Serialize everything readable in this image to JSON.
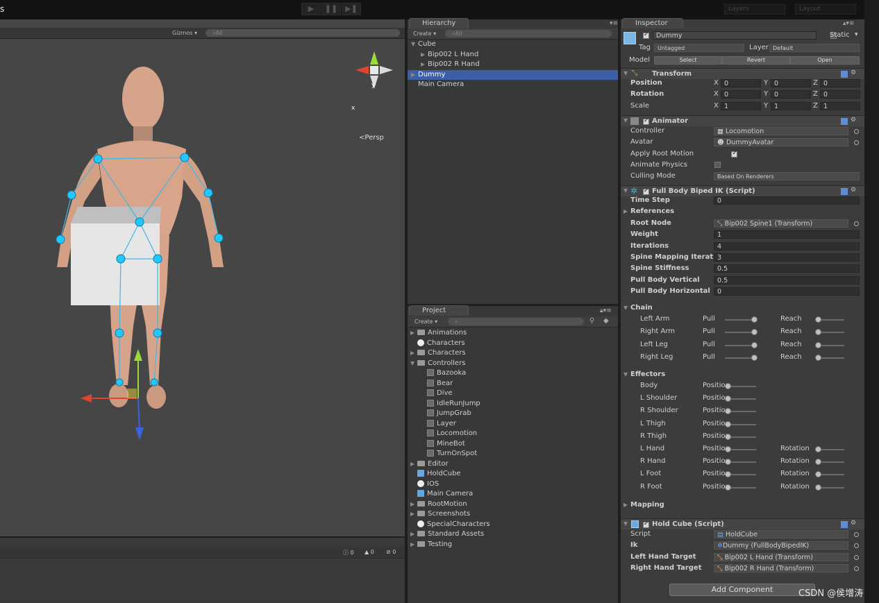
{
  "window": {
    "title": "s",
    "layers": "Layers",
    "layout": "Layout"
  },
  "scene": {
    "gizmos": "Gizmos",
    "search": "All",
    "persp": "Persp",
    "axis_x": "x",
    "axis_y": "y"
  },
  "console": {
    "count_info": "0",
    "count_warn": "0",
    "count_error": "0"
  },
  "hierarchy": {
    "tab": "Hierarchy",
    "create": "Create",
    "search": "All",
    "items": [
      {
        "label": "Cube",
        "indent": 0,
        "arrow": "▼"
      },
      {
        "label": "Bip002 L Hand",
        "indent": 1,
        "arrow": "▶"
      },
      {
        "label": "Bip002 R Hand",
        "indent": 1,
        "arrow": "▶"
      },
      {
        "label": "Dummy",
        "indent": 0,
        "arrow": "▶",
        "selected": true
      },
      {
        "label": "Main Camera",
        "indent": 0,
        "arrow": ""
      }
    ]
  },
  "project": {
    "tab": "Project",
    "create": "Create",
    "items": [
      {
        "label": "Animations",
        "type": "folder",
        "indent": 0,
        "arrow": "▶"
      },
      {
        "label": "Characters",
        "type": "unity",
        "indent": 0,
        "arrow": ""
      },
      {
        "label": "Characters",
        "type": "folder",
        "indent": 0,
        "arrow": "▶"
      },
      {
        "label": "Controllers",
        "type": "folder",
        "indent": 0,
        "arrow": "▼"
      },
      {
        "label": "Bazooka",
        "type": "controller",
        "indent": 1,
        "arrow": ""
      },
      {
        "label": "Bear",
        "type": "controller",
        "indent": 1,
        "arrow": ""
      },
      {
        "label": "Dive",
        "type": "controller",
        "indent": 1,
        "arrow": ""
      },
      {
        "label": "IdleRunJump",
        "type": "controller",
        "indent": 1,
        "arrow": ""
      },
      {
        "label": "JumpGrab",
        "type": "controller",
        "indent": 1,
        "arrow": ""
      },
      {
        "label": "Layer",
        "type": "controller",
        "indent": 1,
        "arrow": ""
      },
      {
        "label": "Locomotion",
        "type": "controller",
        "indent": 1,
        "arrow": ""
      },
      {
        "label": "MineBot",
        "type": "controller",
        "indent": 1,
        "arrow": ""
      },
      {
        "label": "TurnOnSpot",
        "type": "controller",
        "indent": 1,
        "arrow": ""
      },
      {
        "label": "Editor",
        "type": "folder",
        "indent": 0,
        "arrow": "▶"
      },
      {
        "label": "HoldCube",
        "type": "script",
        "indent": 0,
        "arrow": ""
      },
      {
        "label": "IOS",
        "type": "unity",
        "indent": 0,
        "arrow": ""
      },
      {
        "label": "Main Camera",
        "type": "prefab",
        "indent": 0,
        "arrow": ""
      },
      {
        "label": "RootMotion",
        "type": "folder",
        "indent": 0,
        "arrow": "▶"
      },
      {
        "label": "Screenshots",
        "type": "folder",
        "indent": 0,
        "arrow": "▶"
      },
      {
        "label": "SpecialCharacters",
        "type": "unity",
        "indent": 0,
        "arrow": ""
      },
      {
        "label": "Standard Assets",
        "type": "folder",
        "indent": 0,
        "arrow": "▶"
      },
      {
        "label": "Testing",
        "type": "folder",
        "indent": 0,
        "arrow": "▶"
      }
    ]
  },
  "inspector": {
    "tab": "Inspector",
    "object_name": "Dummy",
    "static_label": "Static",
    "tag_label": "Tag",
    "tag_value": "Untagged",
    "layer_label": "Layer",
    "layer_value": "Default",
    "model_label": "Model",
    "select": "Select",
    "revert": "Revert",
    "open": "Open",
    "transform": {
      "title": "Transform",
      "rows": [
        {
          "label": "Position",
          "x": "0",
          "y": "0",
          "z": "0"
        },
        {
          "label": "Rotation",
          "x": "0",
          "y": "0",
          "z": "0"
        },
        {
          "label": "Scale",
          "x": "1",
          "y": "1",
          "z": "1"
        }
      ]
    },
    "animator": {
      "title": "Animator",
      "controller_label": "Controller",
      "controller": "Locomotion",
      "avatar_label": "Avatar",
      "avatar": "DummyAvatar",
      "apply_root_motion": "Apply Root Motion",
      "animate_physics": "Animate Physics",
      "culling_mode_label": "Culling Mode",
      "culling_mode": "Based On Renderers"
    },
    "ik": {
      "title": "Full Body Biped IK (Script)",
      "fields": [
        {
          "label": "Time Step",
          "value": "0",
          "type": "num"
        },
        {
          "label": "References",
          "value": "",
          "type": "foldout"
        },
        {
          "label": "Root Node",
          "value": "Bip002 Spine1 (Transform)",
          "type": "obj"
        },
        {
          "label": "Weight",
          "value": "1",
          "type": "num"
        },
        {
          "label": "Iterations",
          "value": "4",
          "type": "num"
        },
        {
          "label": "Spine Mapping Iteratior",
          "value": "3",
          "type": "num"
        },
        {
          "label": "Spine Stiffness",
          "value": "0.5",
          "type": "num"
        },
        {
          "label": "Pull Body Vertical",
          "value": "0.5",
          "type": "num"
        },
        {
          "label": "Pull Body Horizontal",
          "value": "0",
          "type": "num"
        }
      ],
      "chain_title": "Chain",
      "chain": [
        {
          "label": "Left Arm",
          "a": "Pull",
          "a_val": 1,
          "b": "Reach",
          "b_val": 0
        },
        {
          "label": "Right Arm",
          "a": "Pull",
          "a_val": 1,
          "b": "Reach",
          "b_val": 0
        },
        {
          "label": "Left Leg",
          "a": "Pull",
          "a_val": 1,
          "b": "Reach",
          "b_val": 0
        },
        {
          "label": "Right Leg",
          "a": "Pull",
          "a_val": 1,
          "b": "Reach",
          "b_val": 0
        }
      ],
      "effectors_title": "Effectors",
      "effectors": [
        {
          "label": "Body",
          "a": "Position",
          "a_val": 0,
          "b": "",
          "b_val": null
        },
        {
          "label": "L Shoulder",
          "a": "Position",
          "a_val": 0,
          "b": "",
          "b_val": null
        },
        {
          "label": "R Shoulder",
          "a": "Position",
          "a_val": 0,
          "b": "",
          "b_val": null
        },
        {
          "label": "L Thigh",
          "a": "Position",
          "a_val": 0,
          "b": "",
          "b_val": null
        },
        {
          "label": "R Thigh",
          "a": "Position",
          "a_val": 0,
          "b": "",
          "b_val": null
        },
        {
          "label": "L Hand",
          "a": "Position",
          "a_val": 0,
          "b": "Rotation",
          "b_val": 0
        },
        {
          "label": "R Hand",
          "a": "Position",
          "a_val": 0,
          "b": "Rotation",
          "b_val": 0
        },
        {
          "label": "L Foot",
          "a": "Position",
          "a_val": 0,
          "b": "Rotation",
          "b_val": 0
        },
        {
          "label": "R Foot",
          "a": "Position",
          "a_val": 0,
          "b": "Rotation",
          "b_val": 0
        }
      ],
      "mapping_title": "Mapping"
    },
    "holdcube": {
      "title": "Hold Cube (Script)",
      "fields": [
        {
          "label": "Script",
          "value": "HoldCube"
        },
        {
          "label": "Ik",
          "value": "Dummy (FullBodyBipedIK)"
        },
        {
          "label": "Left Hand Target",
          "value": "Bip002 L Hand (Transform)"
        },
        {
          "label": "Right Hand Target",
          "value": "Bip002 R Hand (Transform)"
        }
      ]
    },
    "add_component": "Add Component"
  },
  "watermark": "CSDN @侯增涛",
  "colors": {
    "selection": "#3d5fa6",
    "ik_dot": "#22c8ff",
    "skin": "#d9a58a"
  }
}
